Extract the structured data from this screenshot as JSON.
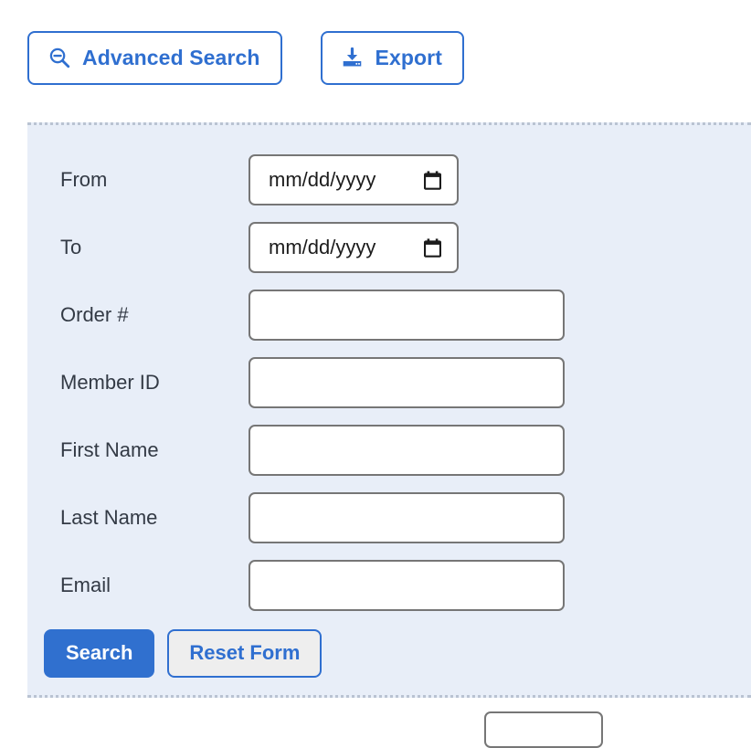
{
  "toolbar": {
    "buttons": [
      {
        "label": "Advanced Search",
        "icon": "search-minus-icon"
      },
      {
        "label": "Export",
        "icon": "download-export-icon"
      }
    ]
  },
  "advanced_search_panel": {
    "fields": [
      {
        "label": "From",
        "type": "date",
        "value": "",
        "placeholder": "mm/dd/yyyy"
      },
      {
        "label": "To",
        "type": "date",
        "value": "",
        "placeholder": "mm/dd/yyyy"
      },
      {
        "label": "Order #",
        "type": "text",
        "value": "",
        "placeholder": ""
      },
      {
        "label": "Member ID",
        "type": "text",
        "value": "",
        "placeholder": ""
      },
      {
        "label": "First Name",
        "type": "text",
        "value": "",
        "placeholder": ""
      },
      {
        "label": "Last Name",
        "type": "text",
        "value": "",
        "placeholder": ""
      },
      {
        "label": "Email",
        "type": "text",
        "value": "",
        "placeholder": ""
      }
    ],
    "actions": {
      "search_label": "Search",
      "reset_label": "Reset Form"
    }
  },
  "colors": {
    "accent_blue": "#2f6fd0",
    "primary_button_blue": "#3070cf",
    "panel_background": "#e8eef8",
    "label_text": "#333a45",
    "input_border": "#767676",
    "panel_dotted_border": "#b9c3d2",
    "secondary_button_fill": "#eeeeee",
    "page_background": "#ffffff"
  }
}
